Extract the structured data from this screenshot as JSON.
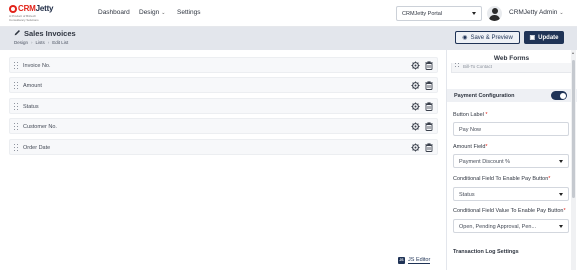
{
  "brand": {
    "name_red": "CRM",
    "name_dark": "Jetty",
    "tagline_1": "A Product of Biztech",
    "tagline_2": "Consultancy Solutions"
  },
  "nav": {
    "dashboard": "Dashboard",
    "design": "Design",
    "settings": "Settings",
    "portal_select": "CRMJetty Portal",
    "user_name": "CRMJetty Admin"
  },
  "page": {
    "title": "Sales Invoices",
    "breadcrumb": [
      "Design",
      "Lists",
      "Edit List"
    ],
    "save_preview": "Save & Preview",
    "update": "Update"
  },
  "fields": [
    {
      "label": "Invoice No."
    },
    {
      "label": "Amount"
    },
    {
      "label": "Status"
    },
    {
      "label": "Customer No."
    },
    {
      "label": "Order Date"
    }
  ],
  "js_editor": {
    "icon_text": "JS",
    "label": "JS Editor"
  },
  "panel": {
    "title": "Web Forms",
    "cut_item": "Bill-To Contact",
    "payment_config": "Payment Configuration",
    "payment_enabled": true,
    "button_label": {
      "label": "Button Label",
      "value": "Pay Now"
    },
    "amount_field": {
      "label": "Amount Field",
      "value": "Payment Discount %"
    },
    "cond_field": {
      "label": "Conditional Field To Enable Pay Button",
      "value": "Status"
    },
    "cond_value": {
      "label": "Conditional Field Value To Enable Pay Button",
      "value": "Open, Pending Approval, Pen..."
    },
    "transaction_log": "Transaction Log Settings",
    "required_mark": "*"
  },
  "colors": {
    "accent": "#1f3356",
    "brand_red": "#e2231a",
    "header_band": "#e3e6ec"
  }
}
